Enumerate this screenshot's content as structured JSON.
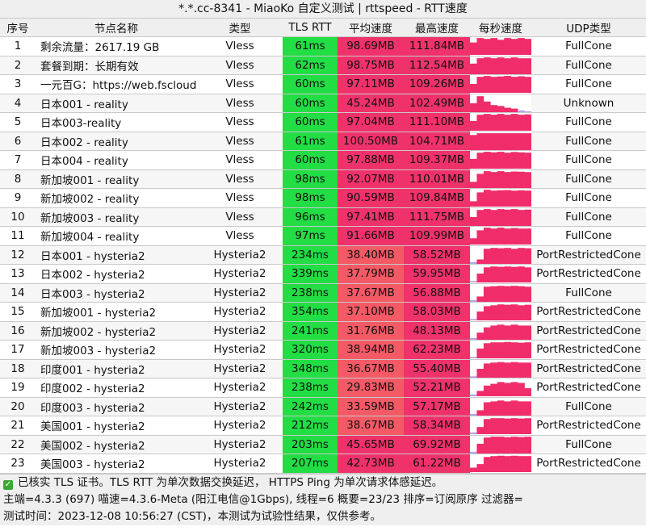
{
  "window_title": "*.*.cc-8341 - MiaoKo 自定义测试 | rttspeed - RTT速度",
  "columns": [
    "序号",
    "节点名称",
    "类型",
    "TLS RTT",
    "平均速度",
    "最高速度",
    "每秒速度",
    "UDP类型"
  ],
  "rows": [
    {
      "idx": "1",
      "name": "剩余流量：2617.19 GB",
      "type": "Vless",
      "rtt": "61ms",
      "avg": "98.69MB",
      "max": "111.84MB",
      "udp": "FullCone",
      "graph": [
        0.7,
        0.95,
        0.9,
        0.95,
        0.85,
        0.95,
        0.9,
        0.95,
        0.9
      ]
    },
    {
      "idx": "2",
      "name": "套餐到期：长期有效",
      "type": "Vless",
      "rtt": "62ms",
      "avg": "98.75MB",
      "max": "112.54MB",
      "udp": "FullCone",
      "graph": [
        0.6,
        0.9,
        0.95,
        0.9,
        0.95,
        0.9,
        0.95,
        0.9,
        0.9
      ]
    },
    {
      "idx": "3",
      "name": "一元百G：https://web.fscloud.cc",
      "type": "Vless",
      "rtt": "60ms",
      "avg": "97.11MB",
      "max": "109.26MB",
      "udp": "FullCone",
      "graph": [
        0.5,
        0.9,
        0.95,
        0.9,
        0.92,
        0.95,
        0.9,
        0.93,
        0.9
      ]
    },
    {
      "idx": "4",
      "name": "日本001 - reality",
      "type": "Vless",
      "rtt": "60ms",
      "avg": "45.24MB",
      "max": "102.49MB",
      "udp": "Unknown",
      "graph": [
        0.5,
        0.9,
        0.6,
        0.4,
        0.35,
        0.25,
        0.2,
        0.1,
        0.05
      ]
    },
    {
      "idx": "5",
      "name": "日本003-reality",
      "type": "Vless",
      "rtt": "60ms",
      "avg": "97.04MB",
      "max": "111.10MB",
      "udp": "FullCone",
      "graph": [
        0.55,
        0.9,
        0.95,
        0.9,
        0.95,
        0.9,
        0.95,
        0.9,
        0.92
      ]
    },
    {
      "idx": "6",
      "name": "日本002 - reality",
      "type": "Vless",
      "rtt": "61ms",
      "avg": "100.50MB",
      "max": "104.71MB",
      "udp": "FullCone",
      "graph": [
        0.85,
        0.95,
        0.95,
        0.95,
        0.95,
        0.95,
        0.95,
        0.95,
        0.95
      ]
    },
    {
      "idx": "7",
      "name": "日本004 - reality",
      "type": "Vless",
      "rtt": "60ms",
      "avg": "97.88MB",
      "max": "109.37MB",
      "udp": "FullCone",
      "graph": [
        0.55,
        0.9,
        0.95,
        0.92,
        0.95,
        0.9,
        0.94,
        0.92,
        0.9
      ]
    },
    {
      "idx": "8",
      "name": "新加坡001 - reality",
      "type": "Vless",
      "rtt": "98ms",
      "avg": "92.07MB",
      "max": "110.01MB",
      "udp": "FullCone",
      "graph": [
        0.35,
        0.8,
        0.95,
        0.9,
        0.95,
        0.9,
        0.93,
        0.92,
        0.9
      ]
    },
    {
      "idx": "9",
      "name": "新加坡002 - reality",
      "type": "Vless",
      "rtt": "98ms",
      "avg": "90.59MB",
      "max": "109.84MB",
      "udp": "FullCone",
      "graph": [
        0.3,
        0.8,
        0.95,
        0.9,
        0.92,
        0.93,
        0.9,
        0.92,
        0.9
      ]
    },
    {
      "idx": "10",
      "name": "新加坡003 - reality",
      "type": "Vless",
      "rtt": "96ms",
      "avg": "97.41MB",
      "max": "111.75MB",
      "udp": "FullCone",
      "graph": [
        0.5,
        0.9,
        0.95,
        0.9,
        0.95,
        0.92,
        0.95,
        0.9,
        0.92
      ]
    },
    {
      "idx": "11",
      "name": "新加坡004 - reality",
      "type": "Vless",
      "rtt": "97ms",
      "avg": "91.66MB",
      "max": "109.99MB",
      "udp": "FullCone",
      "graph": [
        0.35,
        0.8,
        0.95,
        0.9,
        0.95,
        0.9,
        0.93,
        0.9,
        0.9
      ]
    },
    {
      "idx": "12",
      "name": "日本001 - hysteria2",
      "type": "Hysteria2",
      "rtt": "234ms",
      "avg": "38.40MB",
      "max": "58.52MB",
      "udp": "PortRestrictedCone",
      "graph": [
        0.1,
        0.25,
        0.85,
        0.9,
        0.88,
        0.9,
        0.85,
        0.9,
        0.88
      ]
    },
    {
      "idx": "13",
      "name": "日本002 - hysteria2",
      "type": "Hysteria2",
      "rtt": "339ms",
      "avg": "37.79MB",
      "max": "59.95MB",
      "udp": "PortRestrictedCone",
      "graph": [
        0.08,
        0.5,
        0.85,
        0.9,
        0.88,
        0.9,
        0.88,
        0.9,
        0.85
      ]
    },
    {
      "idx": "14",
      "name": "日本003 - hysteria2",
      "type": "Hysteria2",
      "rtt": "238ms",
      "avg": "37.67MB",
      "max": "56.88MB",
      "udp": "FullCone",
      "graph": [
        0.1,
        0.3,
        0.85,
        0.88,
        0.9,
        0.88,
        0.9,
        0.88,
        0.85
      ]
    },
    {
      "idx": "15",
      "name": "新加坡001 - hysteria2",
      "type": "Hysteria2",
      "rtt": "354ms",
      "avg": "37.10MB",
      "max": "58.03MB",
      "udp": "PortRestrictedCone",
      "graph": [
        0.08,
        0.5,
        0.8,
        0.85,
        0.9,
        0.88,
        0.9,
        0.85,
        0.88
      ]
    },
    {
      "idx": "16",
      "name": "新加坡002 - hysteria2",
      "type": "Hysteria2",
      "rtt": "241ms",
      "avg": "31.76MB",
      "max": "48.13MB",
      "udp": "PortRestrictedCone",
      "graph": [
        0.1,
        0.4,
        0.7,
        0.8,
        0.85,
        0.8,
        0.85,
        0.8,
        0.8
      ]
    },
    {
      "idx": "17",
      "name": "新加坡003 - hysteria2",
      "type": "Hysteria2",
      "rtt": "320ms",
      "avg": "38.94MB",
      "max": "62.23MB",
      "udp": "PortRestrictedCone",
      "graph": [
        0.08,
        0.55,
        0.85,
        0.9,
        0.9,
        0.92,
        0.9,
        0.88,
        0.9
      ]
    },
    {
      "idx": "18",
      "name": "印度001 - hysteria2",
      "type": "Hysteria2",
      "rtt": "348ms",
      "avg": "36.67MB",
      "max": "55.40MB",
      "udp": "PortRestrictedCone",
      "graph": [
        0.08,
        0.5,
        0.8,
        0.85,
        0.88,
        0.85,
        0.88,
        0.85,
        0.85
      ]
    },
    {
      "idx": "19",
      "name": "印度002 - hysteria2",
      "type": "Hysteria2",
      "rtt": "238ms",
      "avg": "29.83MB",
      "max": "52.21MB",
      "udp": "PortRestrictedCone",
      "graph": [
        0.1,
        0.3,
        0.6,
        0.7,
        0.8,
        0.75,
        0.8,
        0.75,
        0.45
      ]
    },
    {
      "idx": "20",
      "name": "印度003 - hysteria2",
      "type": "Hysteria2",
      "rtt": "242ms",
      "avg": "33.59MB",
      "max": "57.17MB",
      "udp": "FullCone",
      "graph": [
        0.1,
        0.3,
        0.75,
        0.8,
        0.85,
        0.8,
        0.85,
        0.8,
        0.8
      ]
    },
    {
      "idx": "21",
      "name": "美国001 - hysteria2",
      "type": "Hysteria2",
      "rtt": "212ms",
      "avg": "38.67MB",
      "max": "58.34MB",
      "udp": "PortRestrictedCone",
      "graph": [
        0.1,
        0.4,
        0.85,
        0.9,
        0.9,
        0.88,
        0.9,
        0.88,
        0.9
      ]
    },
    {
      "idx": "22",
      "name": "美国002 - hysteria2",
      "type": "Hysteria2",
      "rtt": "203ms",
      "avg": "45.65MB",
      "max": "69.92MB",
      "udp": "FullCone",
      "graph": [
        0.1,
        0.55,
        0.9,
        0.95,
        0.95,
        0.92,
        0.95,
        0.93,
        0.95
      ]
    },
    {
      "idx": "23",
      "name": "美国003 - hysteria2",
      "type": "Hysteria2",
      "rtt": "207ms",
      "avg": "42.73MB",
      "max": "61.22MB",
      "udp": "PortRestrictedCone",
      "graph": [
        0.25,
        0.45,
        0.85,
        0.9,
        0.92,
        0.9,
        0.92,
        0.9,
        0.9
      ]
    }
  ],
  "footer": {
    "line1": "已核实 TLS 证书。TLS RTT 为单次数据交换延迟， HTTPS Ping 为单次请求体感延迟。",
    "line2": "主端=4.3.3 (697) 喵速=4.3.6-Meta (阳江电信@1Gbps), 线程=6 概要=23/23 排序=订阅原序 过滤器=",
    "line3": "测试时间：2023-12-08 10:56:27 (CST)，本测试为试验性结果，仅供参考。"
  },
  "colors": {
    "rtt_green": "#22dd44",
    "speed_pink": "#f0326b",
    "graph_bar": "#f02d6a",
    "graph_low": "#b9a3e8"
  }
}
